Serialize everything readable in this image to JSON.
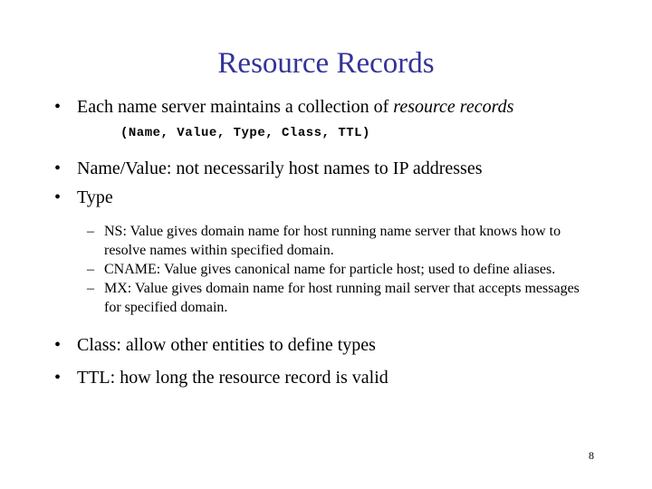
{
  "slide": {
    "title": "Resource Records",
    "title_color": "#333399",
    "background_color": "#ffffff",
    "page_number": "8",
    "bullets": [
      {
        "level": 1,
        "marker": "•",
        "text_before_italic": "Each name server maintains a collection of ",
        "italic_text": "resource records"
      },
      {
        "level": "mono",
        "text": "(Name, Value, Type, Class, TTL)"
      },
      {
        "level": 1,
        "marker": "•",
        "text": "Name/Value: not necessarily host names to IP addresses"
      },
      {
        "level": 1,
        "marker": "•",
        "text": "Type"
      },
      {
        "level": 2,
        "marker": "–",
        "text": "NS: Value gives domain name for host running name server that knows how to resolve names within specified domain."
      },
      {
        "level": 2,
        "marker": "–",
        "text": "CNAME: Value gives canonical name for particle host; used to define aliases."
      },
      {
        "level": 2,
        "marker": "–",
        "text": "MX: Value gives domain name for host running mail server that accepts messages for specified domain."
      },
      {
        "level": 1,
        "marker": "•",
        "text": "Class: allow other entities to define types"
      },
      {
        "level": 1,
        "marker": "•",
        "text": "TTL: how long the resource record is valid"
      }
    ]
  }
}
